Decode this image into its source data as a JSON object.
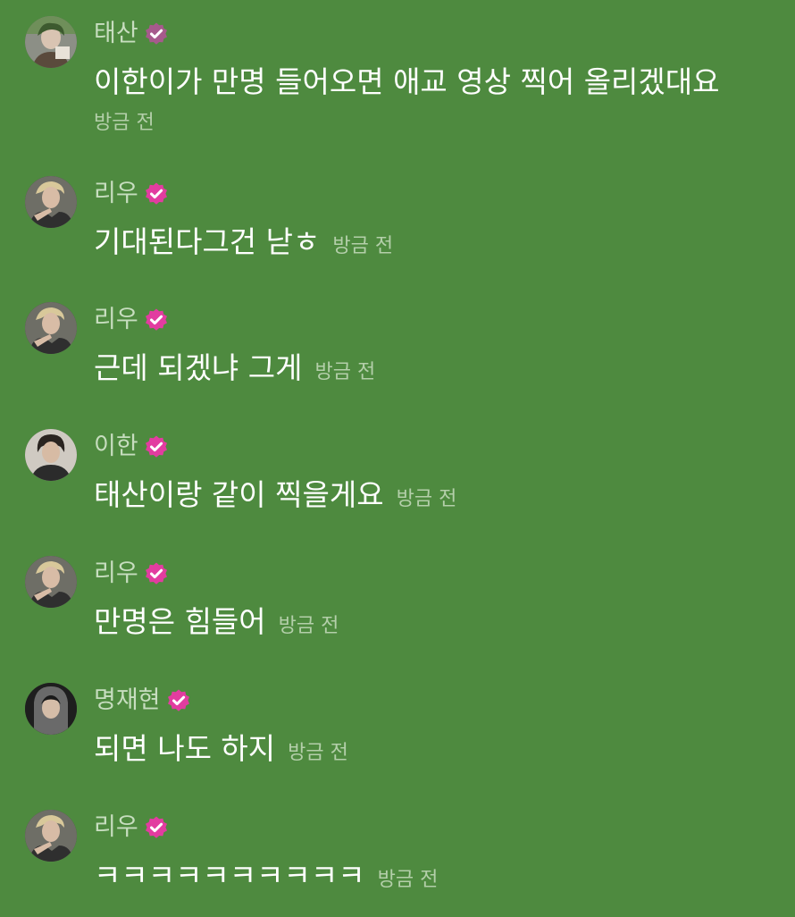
{
  "accent": "#e23ca0",
  "messages": [
    {
      "name": "태산",
      "text": "이한이가 만명 들어오면 애교 영상 찍어 올리겠대요",
      "time": "방금 전"
    },
    {
      "name": "리우",
      "text": "기대된다그건 낟ㅎ",
      "time": "방금 전"
    },
    {
      "name": "리우",
      "text": "근데 되겠냐 그게",
      "time": "방금 전"
    },
    {
      "name": "이한",
      "text": "태산이랑 같이 찍을게요",
      "time": "방금 전"
    },
    {
      "name": "리우",
      "text": "만명은 힘들어",
      "time": "방금 전"
    },
    {
      "name": "명재현",
      "text": "되면 나도 하지",
      "time": "방금 전"
    },
    {
      "name": "리우",
      "text": "ㅋㅋㅋㅋㅋㅋㅋㅋㅋㅋ",
      "time": "방금 전"
    }
  ]
}
